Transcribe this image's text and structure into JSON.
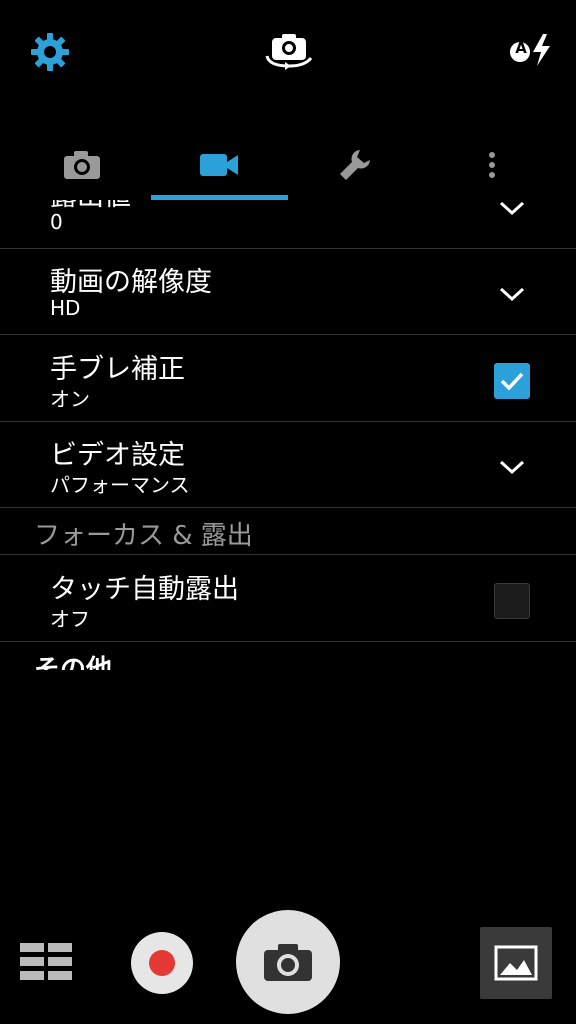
{
  "top_bar": {
    "settings_icon": "gear-icon",
    "switch_camera_icon": "switch-camera-icon",
    "flash_mode": "A",
    "flash_icon": "flash-auto-icon",
    "accent_color": "#2ba0d9"
  },
  "tabs": [
    {
      "icon": "camera-icon",
      "selected": false
    },
    {
      "icon": "video-camera-icon",
      "selected": true
    },
    {
      "icon": "wrench-icon",
      "selected": false
    },
    {
      "icon": "more-vert-icon",
      "selected": false
    }
  ],
  "settings": {
    "partial_row": {
      "title": "露出値",
      "value": "0"
    },
    "video_resolution": {
      "title": "動画の解像度",
      "value": "HD"
    },
    "stabilization": {
      "title": "手ブレ補正",
      "value": "オン",
      "checked": true
    },
    "video_setting": {
      "title": "ビデオ設定",
      "value": "パフォーマンス"
    },
    "focus_section": {
      "label": "フォーカス & 露出"
    },
    "touch_exposure": {
      "title": "タッチ自動露出",
      "value": "オフ",
      "checked": false
    },
    "other_section": {
      "label": "その他"
    }
  },
  "bottom_bar": {
    "mode_icon": "grid-icon",
    "record_icon": "record-icon",
    "shutter_icon": "camera-shutter-icon",
    "gallery_icon": "gallery-icon"
  }
}
